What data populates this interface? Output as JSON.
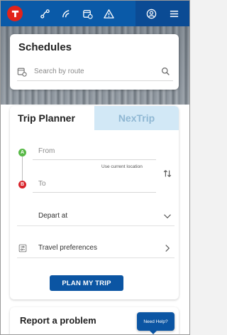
{
  "nav": {
    "icons": [
      "metro-logo-icon",
      "route-icon",
      "signal-icon",
      "bus-schedule-icon",
      "alert-icon",
      "account-icon",
      "menu-icon"
    ]
  },
  "schedules": {
    "title": "Schedules",
    "search_placeholder": "Search by route"
  },
  "planner": {
    "tabs": [
      {
        "label": "Trip Planner",
        "active": true
      },
      {
        "label": "NexTrip",
        "active": false
      }
    ],
    "from_marker": "A",
    "to_marker": "B",
    "from_placeholder": "From",
    "to_placeholder": "To",
    "use_current_location": "Use current location",
    "depart_label": "Depart at",
    "preferences_label": "Travel preferences",
    "plan_button": "PLAN MY TRIP"
  },
  "report": {
    "title": "Report a problem"
  },
  "help": {
    "label": "Need Help?"
  },
  "colors": {
    "nav_blue": "#0a5aa8",
    "brand_red": "#e2231a",
    "tab_inactive_bg": "#d2e8f6",
    "button_blue": "#0b55a3",
    "marker_a": "#58b947",
    "marker_b": "#d8232a"
  }
}
